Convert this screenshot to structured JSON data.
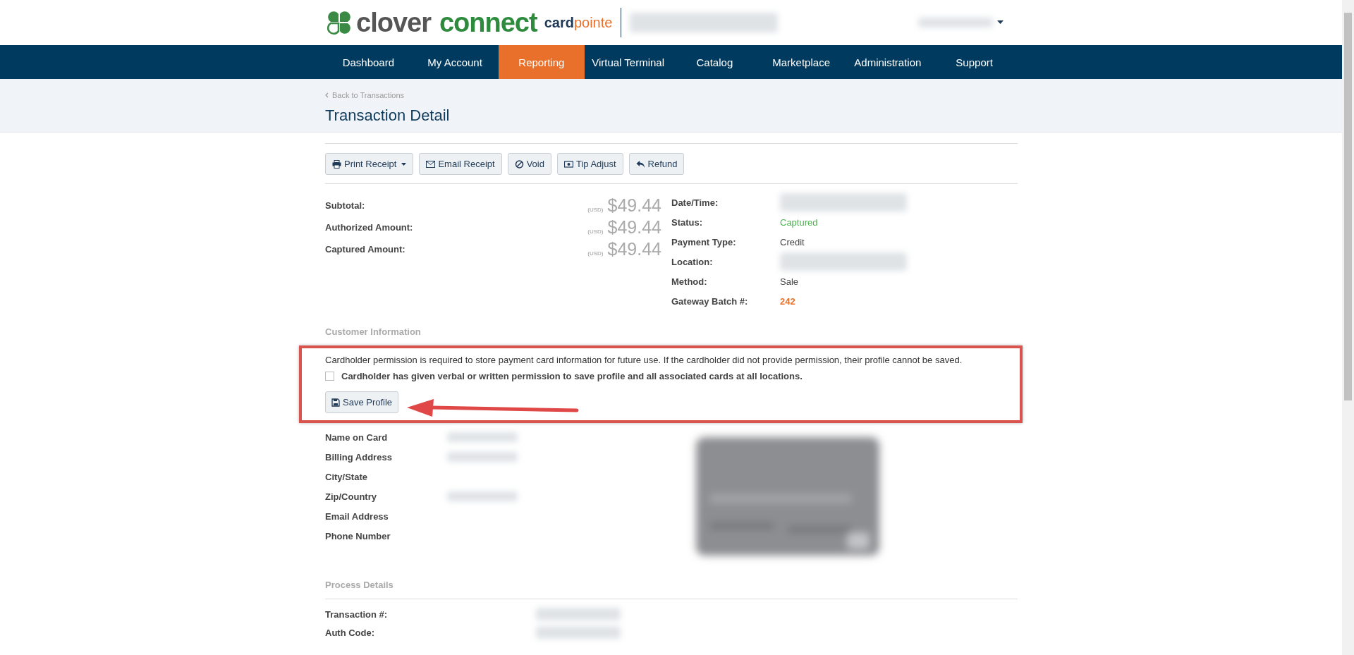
{
  "header": {
    "logo": {
      "brand_1": "clover",
      "brand_2": "connect",
      "product_1": "card",
      "product_2": "pointe"
    },
    "account_menu": {
      "redacted": true
    }
  },
  "nav": [
    {
      "label": "Dashboard",
      "selected": false
    },
    {
      "label": "My Account",
      "selected": false
    },
    {
      "label": "Reporting",
      "selected": true
    },
    {
      "label": "Virtual Terminal",
      "selected": false
    },
    {
      "label": "Catalog",
      "selected": false
    },
    {
      "label": "Marketplace",
      "selected": false
    },
    {
      "label": "Administration",
      "selected": false
    },
    {
      "label": "Support",
      "selected": false
    }
  ],
  "page_header": {
    "back_link": "Back to Transactions",
    "title": "Transaction Detail"
  },
  "actions": [
    {
      "label": "Print Receipt",
      "has_menu": true
    },
    {
      "label": "Email Receipt",
      "has_menu": false
    },
    {
      "label": "Void",
      "has_menu": false
    },
    {
      "label": "Tip Adjust",
      "has_menu": false
    },
    {
      "label": "Refund",
      "has_menu": false
    }
  ],
  "amounts": [
    {
      "label": "Subtotal:",
      "currency": "(USD)",
      "value": "$49.44"
    },
    {
      "label": "Authorized Amount:",
      "currency": "(USD)",
      "value": "$49.44"
    },
    {
      "label": "Captured Amount:",
      "currency": "(USD)",
      "value": "$49.44"
    }
  ],
  "details": [
    {
      "label": "Date/Time:",
      "kind": "redacted"
    },
    {
      "label": "Status:",
      "value": "Captured",
      "kind": "status"
    },
    {
      "label": "Payment Type:",
      "value": "Credit",
      "kind": "plain"
    },
    {
      "label": "Location:",
      "kind": "redacted"
    },
    {
      "label": "Method:",
      "value": "Sale",
      "kind": "plain"
    },
    {
      "label": "Gateway Batch #:",
      "value": "242",
      "kind": "batch"
    }
  ],
  "customer": {
    "heading": "Customer Information",
    "notice": "Cardholder permission is required to store payment card information for future use. If the cardholder did not provide permission, their profile cannot be saved.",
    "permission": {
      "label": "Cardholder has given verbal or written permission to save profile and all associated cards at all locations.",
      "checked": false
    },
    "save_button": "Save Profile",
    "fields": [
      {
        "label": "Name on Card",
        "redacted": true
      },
      {
        "label": "Billing Address",
        "redacted": true
      },
      {
        "label": "City/State",
        "redacted": false
      },
      {
        "label": "Zip/Country",
        "redacted": true
      },
      {
        "label": "Email Address",
        "redacted": false
      },
      {
        "label": "Phone Number",
        "redacted": false
      }
    ]
  },
  "process": {
    "heading": "Process Details",
    "fields": [
      {
        "label": "Transaction #:",
        "redacted": true
      },
      {
        "label": "Auth Code:",
        "redacted": true
      }
    ]
  }
}
